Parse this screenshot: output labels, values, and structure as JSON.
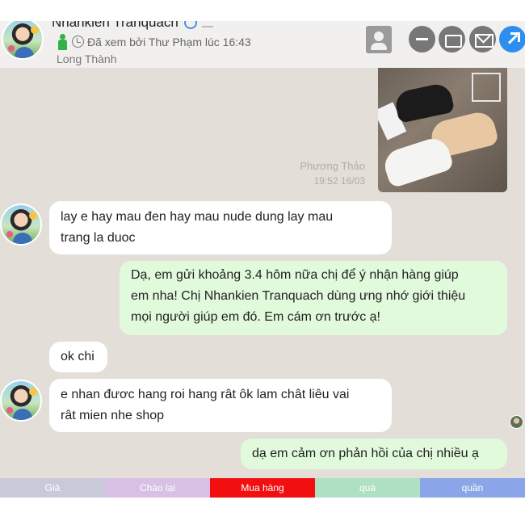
{
  "header": {
    "name": "Nhankien Tranquach",
    "seen_status": "Đã xem bởi Thư Phạm lúc 16:43",
    "location": "Long Thành"
  },
  "image_message": {
    "sender": "Phương Thảo",
    "timestamp": "19:52 16/03"
  },
  "messages": [
    {
      "direction": "incoming",
      "text_lines": [
        "lay e hay mau đen hay mau nude dung lay mau",
        "trang la duoc"
      ]
    },
    {
      "direction": "outgoing",
      "text_lines": [
        "Dạ, em gửi khoảng 3.4 hôm nữa chị để ý nhận hàng giúp",
        "em nha! Chị Nhankien Tranquach dùng ưng nhớ giới thiệu",
        "mọi người giúp em đó. Em cám ơn trước ạ!"
      ]
    },
    {
      "direction": "incoming",
      "text_lines": [
        "ok chi"
      ]
    },
    {
      "direction": "incoming",
      "text_lines": [
        "e nhan đươc hang roi hang rât ôk lam chât liêu vai",
        "rât mien nhe shop"
      ]
    },
    {
      "direction": "outgoing",
      "text_lines": [
        "dạ em cảm ơn phản hồi của chị nhiều ạ"
      ]
    }
  ],
  "tabs": [
    {
      "label": "Giá",
      "color": "#c9cad9"
    },
    {
      "label": "Chào lại",
      "color": "#d8c0e4"
    },
    {
      "label": "Mua hàng",
      "color": "#f10f10"
    },
    {
      "label": "quà",
      "color": "#aee0c3"
    },
    {
      "label": "quần",
      "color": "#8aa6e8"
    }
  ],
  "icons": {
    "header": [
      "avatar",
      "verified-icon",
      "person-icon",
      "clock-icon",
      "contact-card-icon",
      "minimize-icon",
      "inbox-icon",
      "mail-icon",
      "share-icon"
    ]
  },
  "colors": {
    "chat_background": "#e4ded9",
    "incoming_bubble": "#ffffff",
    "outgoing_bubble": "#e2fadc",
    "share_button": "#2c8ef0"
  }
}
